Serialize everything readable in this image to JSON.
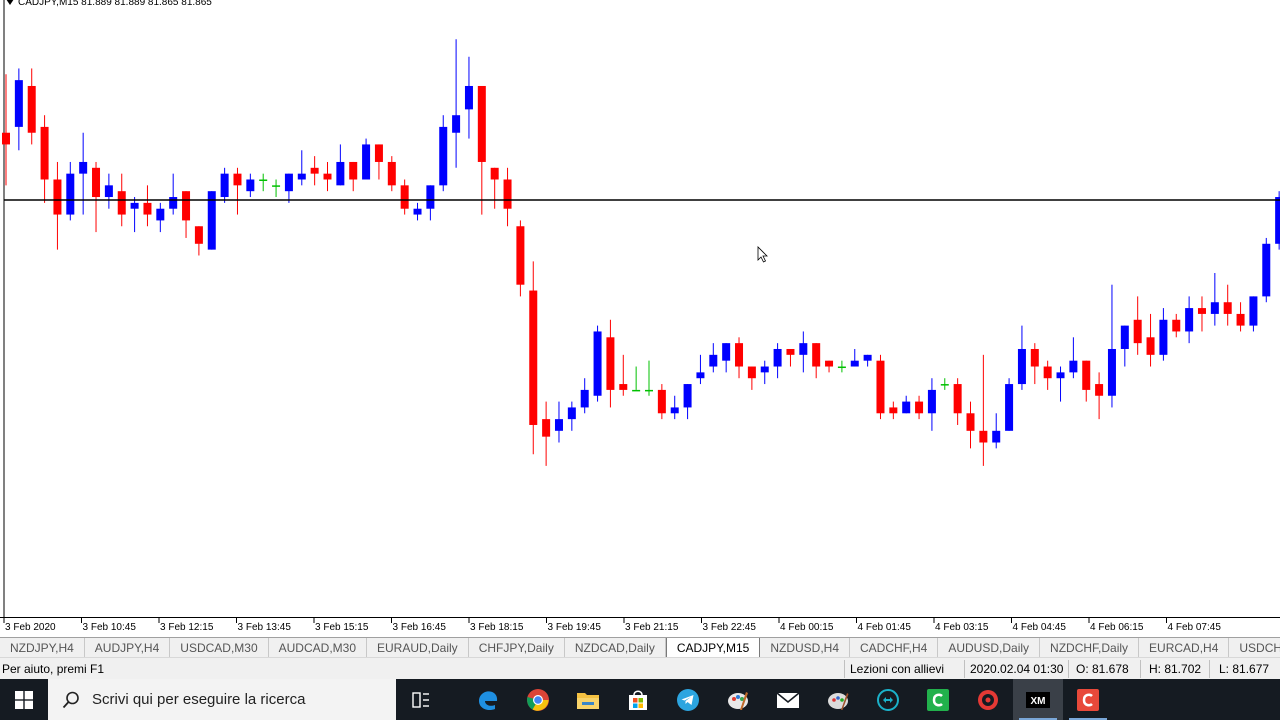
{
  "chart": {
    "header": "CADJPY,M15  81.889 81.889 81.865 81.865",
    "bull_color": "#0000ff",
    "bear_color": "#ff0000",
    "doji_color": "#00c000",
    "hline_price": 81.745,
    "price_range": [
      81.04,
      82.07
    ],
    "time_labels": [
      "3 Feb 2020",
      "3 Feb 10:45",
      "3 Feb 12:15",
      "3 Feb 13:45",
      "3 Feb 15:15",
      "3 Feb 16:45",
      "3 Feb 18:15",
      "3 Feb 19:45",
      "3 Feb 21:15",
      "3 Feb 22:45",
      "4 Feb 00:15",
      "4 Feb 01:45",
      "4 Feb 03:15",
      "4 Feb 04:45",
      "4 Feb 06:15",
      "4 Feb 07:45"
    ]
  },
  "chart_data": {
    "type": "candlestick",
    "symbol": "CADJPY,M15",
    "header_values": {
      "open": 81.889,
      "high": 81.889,
      "low": 81.865,
      "close": 81.865
    },
    "ylim": [
      81.04,
      82.07
    ],
    "candles": [
      [
        81.86,
        81.84,
        81.96,
        81.77
      ],
      [
        81.87,
        81.95,
        81.97,
        81.83
      ],
      [
        81.94,
        81.86,
        81.97,
        81.84
      ],
      [
        81.87,
        81.78,
        81.89,
        81.74
      ],
      [
        81.78,
        81.72,
        81.81,
        81.66
      ],
      [
        81.72,
        81.79,
        81.81,
        81.71
      ],
      [
        81.79,
        81.81,
        81.86,
        81.72
      ],
      [
        81.8,
        81.75,
        81.81,
        81.69
      ],
      [
        81.75,
        81.77,
        81.79,
        81.73
      ],
      [
        81.76,
        81.72,
        81.79,
        81.7
      ],
      [
        81.73,
        81.74,
        81.75,
        81.69
      ],
      [
        81.74,
        81.72,
        81.77,
        81.7
      ],
      [
        81.71,
        81.73,
        81.74,
        81.69
      ],
      [
        81.73,
        81.75,
        81.79,
        81.72
      ],
      [
        81.76,
        81.71,
        81.76,
        81.68
      ],
      [
        81.7,
        81.67,
        81.7,
        81.65
      ],
      [
        81.66,
        81.76,
        81.76,
        81.66
      ],
      [
        81.75,
        81.79,
        81.8,
        81.74
      ],
      [
        81.79,
        81.77,
        81.8,
        81.72
      ],
      [
        81.76,
        81.78,
        81.79,
        81.75
      ],
      [
        81.78,
        81.78,
        81.79,
        81.76
      ],
      [
        81.77,
        81.77,
        81.78,
        81.75
      ],
      [
        81.76,
        81.79,
        81.79,
        81.74
      ],
      [
        81.78,
        81.79,
        81.83,
        81.77
      ],
      [
        81.8,
        81.79,
        81.82,
        81.77
      ],
      [
        81.79,
        81.78,
        81.81,
        81.76
      ],
      [
        81.77,
        81.81,
        81.84,
        81.77
      ],
      [
        81.81,
        81.78,
        81.81,
        81.76
      ],
      [
        81.78,
        81.84,
        81.85,
        81.78
      ],
      [
        81.84,
        81.81,
        81.84,
        81.78
      ],
      [
        81.81,
        81.77,
        81.82,
        81.76
      ],
      [
        81.77,
        81.73,
        81.78,
        81.72
      ],
      [
        81.72,
        81.73,
        81.74,
        81.71
      ],
      [
        81.73,
        81.77,
        81.77,
        81.71
      ],
      [
        81.77,
        81.87,
        81.89,
        81.76
      ],
      [
        81.86,
        81.89,
        82.02,
        81.8
      ],
      [
        81.9,
        81.94,
        81.99,
        81.85
      ],
      [
        81.94,
        81.81,
        81.94,
        81.72
      ],
      [
        81.8,
        81.78,
        81.8,
        81.73
      ],
      [
        81.78,
        81.73,
        81.8,
        81.7
      ],
      [
        81.7,
        81.6,
        81.71,
        81.58
      ],
      [
        81.59,
        81.36,
        81.64,
        81.31
      ],
      [
        81.37,
        81.34,
        81.4,
        81.29
      ],
      [
        81.35,
        81.37,
        81.4,
        81.33
      ],
      [
        81.37,
        81.39,
        81.4,
        81.35
      ],
      [
        81.39,
        81.42,
        81.44,
        81.38
      ],
      [
        81.41,
        81.52,
        81.53,
        81.4
      ],
      [
        81.51,
        81.42,
        81.54,
        81.39
      ],
      [
        81.43,
        81.42,
        81.48,
        81.41
      ],
      [
        81.42,
        81.42,
        81.46,
        81.42
      ],
      [
        81.42,
        81.42,
        81.47,
        81.41
      ],
      [
        81.42,
        81.38,
        81.43,
        81.37
      ],
      [
        81.38,
        81.39,
        81.41,
        81.37
      ],
      [
        81.39,
        81.43,
        81.43,
        81.37
      ],
      [
        81.44,
        81.45,
        81.48,
        81.43
      ],
      [
        81.46,
        81.48,
        81.5,
        81.45
      ],
      [
        81.47,
        81.5,
        81.5,
        81.45
      ],
      [
        81.5,
        81.46,
        81.51,
        81.44
      ],
      [
        81.46,
        81.44,
        81.46,
        81.42
      ],
      [
        81.45,
        81.46,
        81.47,
        81.43
      ],
      [
        81.46,
        81.49,
        81.5,
        81.44
      ],
      [
        81.49,
        81.48,
        81.49,
        81.46
      ],
      [
        81.48,
        81.5,
        81.52,
        81.45
      ],
      [
        81.5,
        81.46,
        81.5,
        81.44
      ],
      [
        81.47,
        81.46,
        81.47,
        81.45
      ],
      [
        81.46,
        81.46,
        81.47,
        81.45
      ],
      [
        81.46,
        81.47,
        81.49,
        81.46
      ],
      [
        81.47,
        81.48,
        81.48,
        81.46
      ],
      [
        81.47,
        81.38,
        81.48,
        81.37
      ],
      [
        81.39,
        81.38,
        81.4,
        81.37
      ],
      [
        81.38,
        81.4,
        81.41,
        81.38
      ],
      [
        81.4,
        81.38,
        81.41,
        81.37
      ],
      [
        81.38,
        81.42,
        81.44,
        81.35
      ],
      [
        81.43,
        81.43,
        81.44,
        81.42
      ],
      [
        81.43,
        81.38,
        81.44,
        81.36
      ],
      [
        81.38,
        81.35,
        81.4,
        81.32
      ],
      [
        81.35,
        81.33,
        81.48,
        81.29
      ],
      [
        81.33,
        81.35,
        81.38,
        81.32
      ],
      [
        81.35,
        81.43,
        81.44,
        81.35
      ],
      [
        81.43,
        81.49,
        81.53,
        81.42
      ],
      [
        81.49,
        81.46,
        81.5,
        81.43
      ],
      [
        81.46,
        81.44,
        81.47,
        81.42
      ],
      [
        81.44,
        81.45,
        81.46,
        81.4
      ],
      [
        81.45,
        81.47,
        81.51,
        81.44
      ],
      [
        81.47,
        81.42,
        81.47,
        81.4
      ],
      [
        81.43,
        81.41,
        81.45,
        81.37
      ],
      [
        81.41,
        81.49,
        81.6,
        81.39
      ],
      [
        81.49,
        81.53,
        81.53,
        81.46
      ],
      [
        81.54,
        81.5,
        81.58,
        81.48
      ],
      [
        81.51,
        81.48,
        81.55,
        81.46
      ],
      [
        81.48,
        81.54,
        81.56,
        81.47
      ],
      [
        81.54,
        81.52,
        81.55,
        81.51
      ],
      [
        81.52,
        81.56,
        81.58,
        81.5
      ],
      [
        81.56,
        81.55,
        81.58,
        81.52
      ],
      [
        81.55,
        81.57,
        81.62,
        81.53
      ],
      [
        81.57,
        81.55,
        81.6,
        81.53
      ],
      [
        81.55,
        81.53,
        81.57,
        81.52
      ],
      [
        81.53,
        81.58,
        81.58,
        81.52
      ],
      [
        81.58,
        81.67,
        81.68,
        81.57
      ],
      [
        81.67,
        81.75,
        81.76,
        81.66
      ],
      [
        81.74,
        81.7,
        81.75,
        81.69
      ]
    ]
  },
  "tabs": [
    "NZDJPY,H4",
    "AUDJPY,H4",
    "USDCAD,M30",
    "AUDCAD,M30",
    "EURAUD,Daily",
    "CHFJPY,Daily",
    "NZDCAD,Daily",
    "CADJPY,M15",
    "NZDUSD,H4",
    "CADCHF,H4",
    "AUDUSD,Daily",
    "NZDCHF,Daily",
    "EURCAD,H4",
    "USDCHF,Daily"
  ],
  "active_tab": "CADJPY,M15",
  "status": {
    "help": "Per aiuto, premi F1",
    "profile": "Lezioni con allievi",
    "datetime": "2020.02.04 01:30",
    "open": "O: 81.678",
    "high": "H: 81.702",
    "low": "L: 81.677"
  },
  "taskbar": {
    "search_placeholder": "Scrivi qui per eseguire la ricerca",
    "icons": [
      "task-view-icon",
      "edge-icon",
      "chrome-icon",
      "file-explorer-icon",
      "store-icon",
      "telegram-icon",
      "paint-icon",
      "mail-icon",
      "app-icon",
      "teamviewer-icon",
      "green-c-icon",
      "red-app-icon",
      "xm-icon",
      "red-c-icon"
    ]
  }
}
